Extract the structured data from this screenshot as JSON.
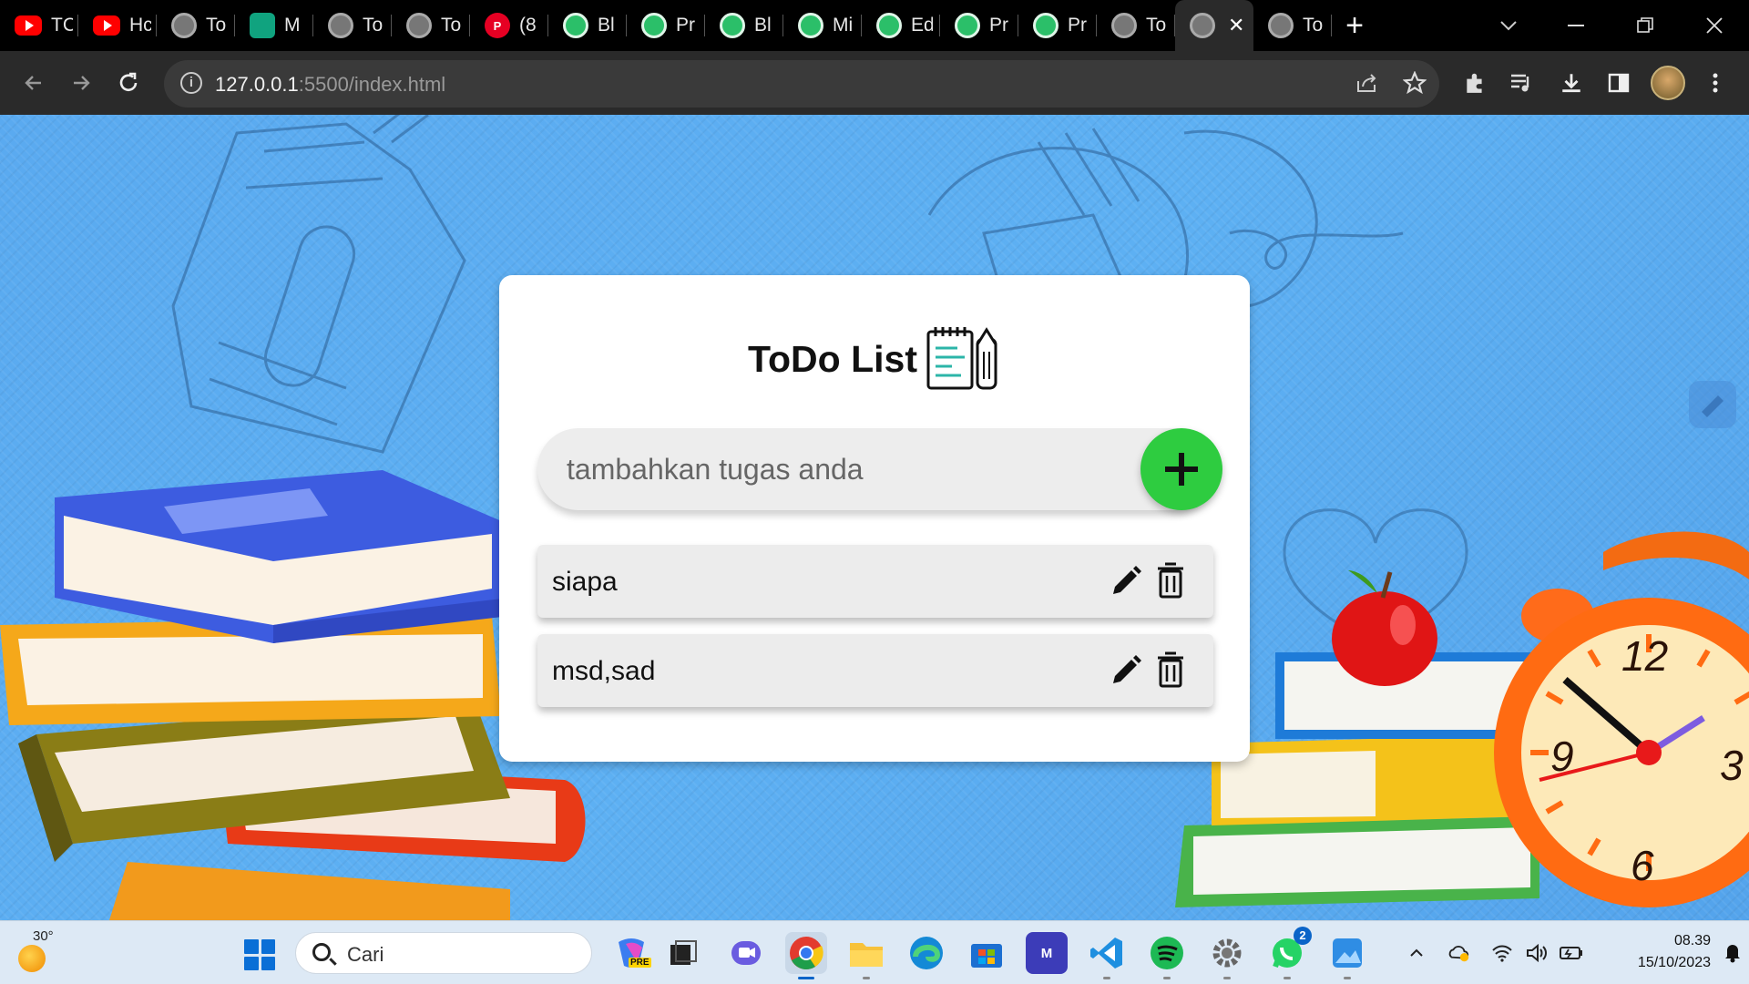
{
  "browser": {
    "tabs": [
      {
        "label": "TC",
        "favicon": "youtube-icon"
      },
      {
        "label": "Hc",
        "favicon": "youtube-icon"
      },
      {
        "label": "To",
        "favicon": "globe-icon"
      },
      {
        "label": "M",
        "favicon": "chatgpt-icon"
      },
      {
        "label": "To",
        "favicon": "globe-icon"
      },
      {
        "label": "To",
        "favicon": "globe-icon"
      },
      {
        "label": "(8",
        "favicon": "pinterest-icon"
      },
      {
        "label": "Bl",
        "favicon": "green-app-icon"
      },
      {
        "label": "Pr",
        "favicon": "green-app-icon"
      },
      {
        "label": "Bl",
        "favicon": "green-app-icon"
      },
      {
        "label": "Mi",
        "favicon": "green-app-icon"
      },
      {
        "label": "Ed",
        "favicon": "green-app-icon"
      },
      {
        "label": "Pr",
        "favicon": "green-app-icon"
      },
      {
        "label": "Pr",
        "favicon": "green-app-icon"
      },
      {
        "label": "To",
        "favicon": "globe-icon"
      },
      {
        "label": "",
        "favicon": "globe-icon",
        "active": true
      },
      {
        "label": "To",
        "favicon": "globe-icon"
      }
    ],
    "close_tab_glyph": "✕",
    "new_tab_glyph": "+",
    "url_host": "127.0.0.1",
    "url_rest": ":5500/index.html"
  },
  "app": {
    "title": "ToDo List",
    "input_placeholder": "tambahkan tugas anda",
    "add_glyph": "+",
    "accent_color": "#2ecc40",
    "tasks": [
      {
        "text": "siapa"
      },
      {
        "text": "msd,sad"
      }
    ]
  },
  "taskbar": {
    "weather_temp": "30°",
    "search_placeholder": "Cari",
    "copilot_badge": "PRE",
    "whatsapp_badge": "2",
    "time": "08.39",
    "date": "15/10/2023"
  }
}
